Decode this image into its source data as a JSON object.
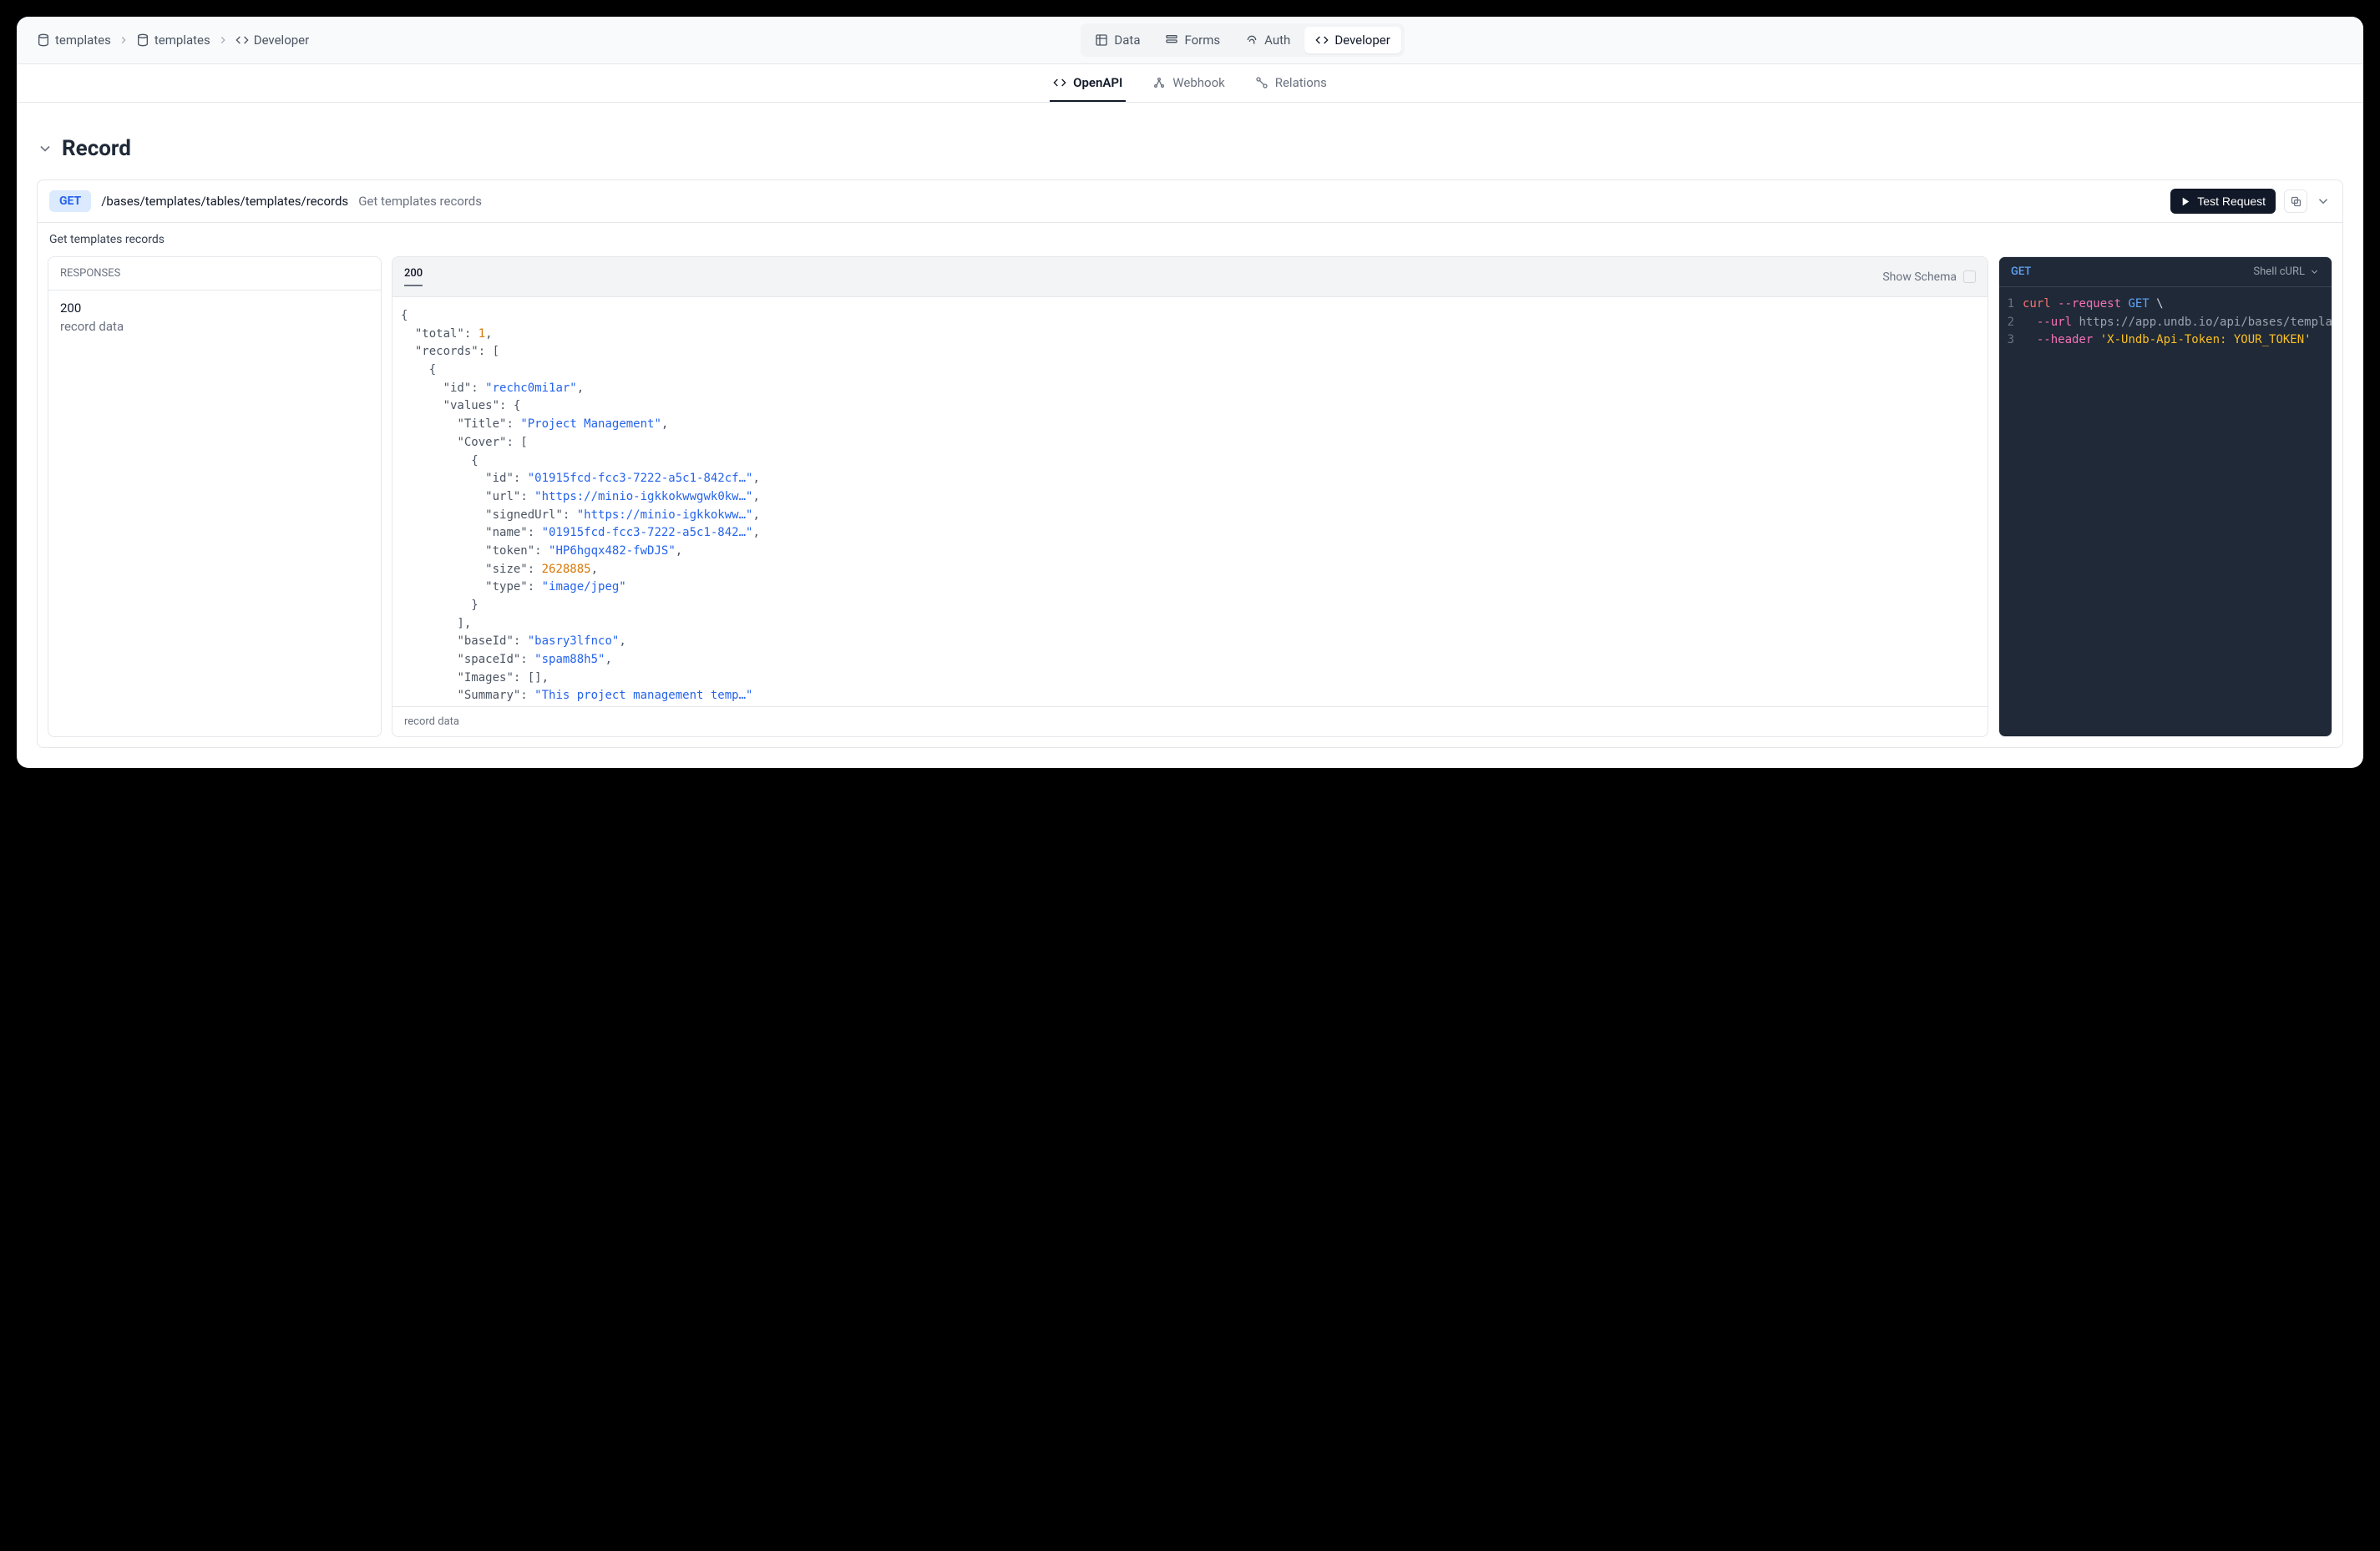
{
  "breadcrumb": {
    "items": [
      {
        "label": "templates",
        "icon": "database"
      },
      {
        "label": "templates",
        "icon": "database"
      },
      {
        "label": "Developer",
        "icon": "code"
      }
    ]
  },
  "topnav": {
    "items": [
      {
        "label": "Data",
        "icon": "table",
        "active": false
      },
      {
        "label": "Forms",
        "icon": "forms",
        "active": false
      },
      {
        "label": "Auth",
        "icon": "fingerprint",
        "active": false
      },
      {
        "label": "Developer",
        "icon": "code",
        "active": true
      }
    ]
  },
  "subtabs": {
    "items": [
      {
        "label": "OpenAPI",
        "icon": "code",
        "active": true
      },
      {
        "label": "Webhook",
        "icon": "webhook",
        "active": false
      },
      {
        "label": "Relations",
        "icon": "relations",
        "active": false
      }
    ]
  },
  "section": {
    "title": "Record"
  },
  "endpoint": {
    "method": "GET",
    "path": "/bases/templates/tables/templates/records",
    "title": "Get templates records",
    "description": "Get templates records",
    "test_label": "Test Request"
  },
  "responses": {
    "heading": "RESPONSES",
    "items": [
      {
        "status": "200",
        "label": "record data"
      }
    ]
  },
  "example": {
    "tab": "200",
    "schema_label": "Show Schema",
    "footer": "record data",
    "json": {
      "total": 1,
      "records": [
        {
          "id": "rechc0mi1ar",
          "values": {
            "Title": "Project Management",
            "Cover": [
              {
                "id": "01915fcd-fcc3-7222-a5c1-842cf…",
                "url": "https://minio-igkkokwwgwk0kw…",
                "signedUrl": "https://minio-igkkokww…",
                "name": "01915fcd-fcc3-7222-a5c1-842…",
                "token": "HP6hgqx482-fwDJS",
                "size": 2628885,
                "type": "image/jpeg"
              }
            ],
            "baseId": "basry3lfnco",
            "spaceId": "spam88h5",
            "Images": [],
            "Summary": "This project management temp…"
          },
          "displayValues": {}
        }
      ]
    }
  },
  "codepanel": {
    "method": "GET",
    "lang_label": "Shell cURL",
    "lines": [
      {
        "n": 1,
        "parts": [
          {
            "t": "cmd",
            "v": "curl"
          },
          {
            "t": "p",
            "v": " "
          },
          {
            "t": "flag",
            "v": "--request"
          },
          {
            "t": "p",
            "v": " "
          },
          {
            "t": "mthd",
            "v": "GET"
          },
          {
            "t": "p",
            "v": " \\"
          }
        ]
      },
      {
        "n": 2,
        "parts": [
          {
            "t": "p",
            "v": "  "
          },
          {
            "t": "flag",
            "v": "--url"
          },
          {
            "t": "p",
            "v": " "
          },
          {
            "t": "url",
            "v": "https://app.undb.io/api/bases/template"
          }
        ]
      },
      {
        "n": 3,
        "parts": [
          {
            "t": "p",
            "v": "  "
          },
          {
            "t": "flag",
            "v": "--header"
          },
          {
            "t": "p",
            "v": " "
          },
          {
            "t": "lit",
            "v": "'X-Undb-Api-Token: YOUR_TOKEN'"
          }
        ]
      }
    ]
  }
}
